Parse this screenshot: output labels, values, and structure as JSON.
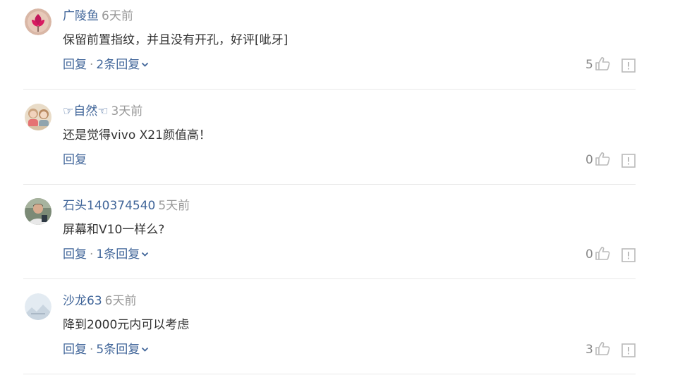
{
  "comments": [
    {
      "username": "广陵鱼",
      "time": "6天前",
      "content": "保留前置指纹，并且没有开孔，好评[呲牙]",
      "reply_label": "回复",
      "separator": "·",
      "replies_label": "2条回复",
      "likes": "5",
      "avatar_icon": "pink-lotus-avatar"
    },
    {
      "username": "☞自然☜",
      "time": "3天前",
      "content": "还是觉得vivo X21颜值高！",
      "reply_label": "回复",
      "likes": "0",
      "avatar_icon": "dolls-photo-avatar"
    },
    {
      "username": "石头140374540",
      "time": "5天前",
      "content": "屏幕和V10一样么?",
      "reply_label": "回复",
      "separator": "·",
      "replies_label": "1条回复",
      "likes": "0",
      "avatar_icon": "person-photo-avatar"
    },
    {
      "username": "沙龙63",
      "time": "6天前",
      "content": "降到2000元内可以考虑",
      "reply_label": "回复",
      "separator": "·",
      "replies_label": "5条回复",
      "likes": "3",
      "avatar_icon": "landscape-avatar"
    }
  ],
  "colors": {
    "username": "#406599",
    "text": "#333333",
    "muted": "#999999",
    "divider": "#e9e9e9"
  },
  "icons": [
    "thumbs-up-icon",
    "report-icon",
    "chevron-down-icon"
  ]
}
